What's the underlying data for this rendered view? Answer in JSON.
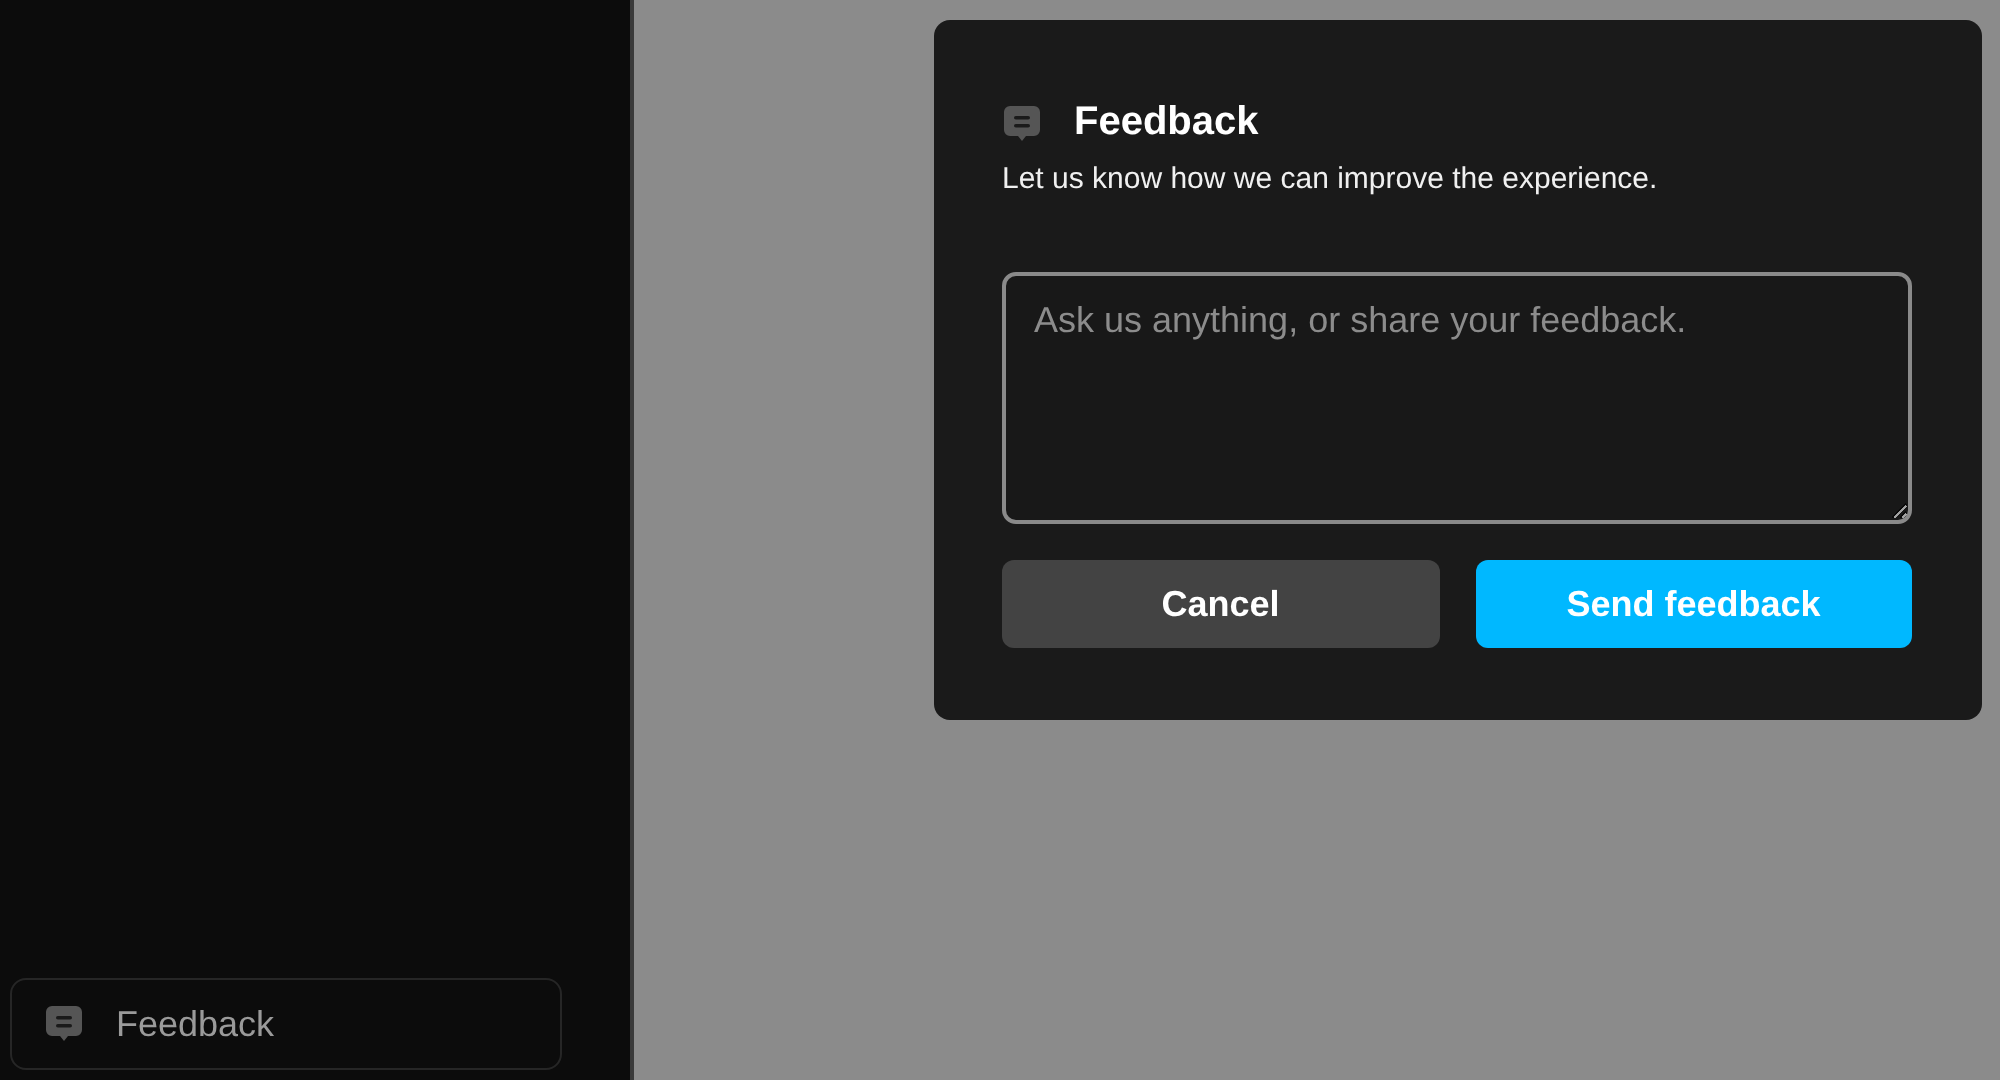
{
  "sidebar": {
    "feedback_button": {
      "label": "Feedback"
    }
  },
  "dialog": {
    "title": "Feedback",
    "subtitle": "Let us know how we can improve the experience.",
    "message": {
      "placeholder": "Ask us anything, or share your feedback."
    },
    "buttons": [
      {
        "kind": "secondary",
        "label": "Cancel"
      },
      {
        "kind": "primary",
        "label": "Send feedback"
      }
    ]
  }
}
